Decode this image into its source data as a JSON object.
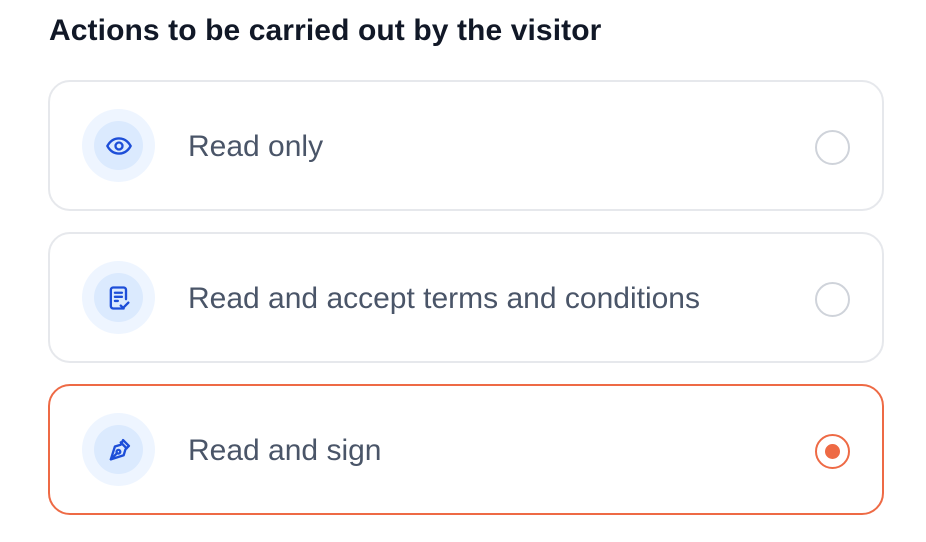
{
  "heading": "Actions to be carried out by the visitor",
  "colors": {
    "accent": "#ee6a45",
    "icon": "#1d4ed8",
    "icon_bg": "#dbeafe",
    "icon_bg_outer": "#eef5ff",
    "border": "#e6e8ec",
    "label": "#4a5568",
    "heading": "#111827"
  },
  "options": [
    {
      "label": "Read only",
      "icon": "eye-icon",
      "selected": false
    },
    {
      "label": "Read and accept terms and conditions",
      "icon": "document-check-icon",
      "selected": false
    },
    {
      "label": "Read and sign",
      "icon": "pen-nib-icon",
      "selected": true
    }
  ]
}
